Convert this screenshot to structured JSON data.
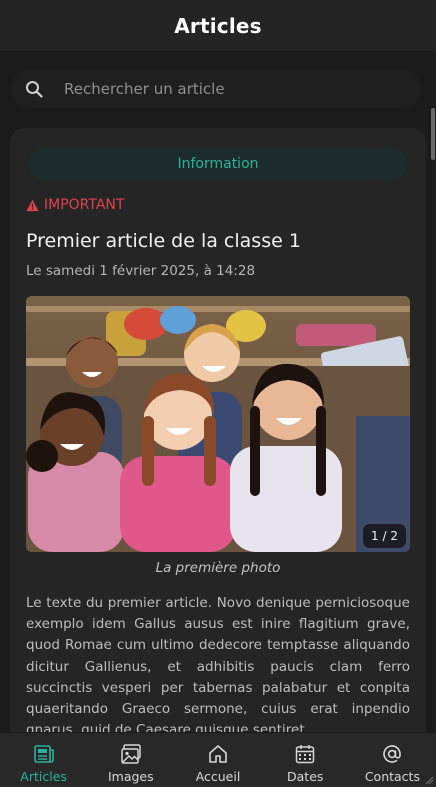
{
  "header": {
    "title": "Articles"
  },
  "search": {
    "placeholder": "Rechercher un article"
  },
  "article": {
    "category": "Information",
    "badge": "IMPORTANT",
    "title": "Premier article de la classe 1",
    "date": "Le samedi 1 février 2025, à 14:28",
    "photo_counter": "1 / 2",
    "photo_caption": "La première photo",
    "body": "Le texte du premier article. Novo denique perniciosoque exemplo idem Gallus ausus est inire flagitium grave, quod Romae cum ultimo dedecore temptasse aliquando dicitur Gallienus, et adhibitis paucis clam ferro succinctis vesperi per tabernas palabatur et conpita quaeritando Graeco sermone, cuius erat inpendio gnarus, quid de Caesare quisque sentiret."
  },
  "nav": [
    {
      "label": "Articles",
      "icon": "newspaper-icon",
      "active": true
    },
    {
      "label": "Images",
      "icon": "images-icon",
      "active": false
    },
    {
      "label": "Accueil",
      "icon": "home-icon",
      "active": false
    },
    {
      "label": "Dates",
      "icon": "calendar-icon",
      "active": false
    },
    {
      "label": "Contacts",
      "icon": "at-icon",
      "active": false
    }
  ],
  "colors": {
    "accent": "#2bb39a",
    "important": "#e0424f",
    "background": "#1b1b1b",
    "card": "#252525"
  }
}
